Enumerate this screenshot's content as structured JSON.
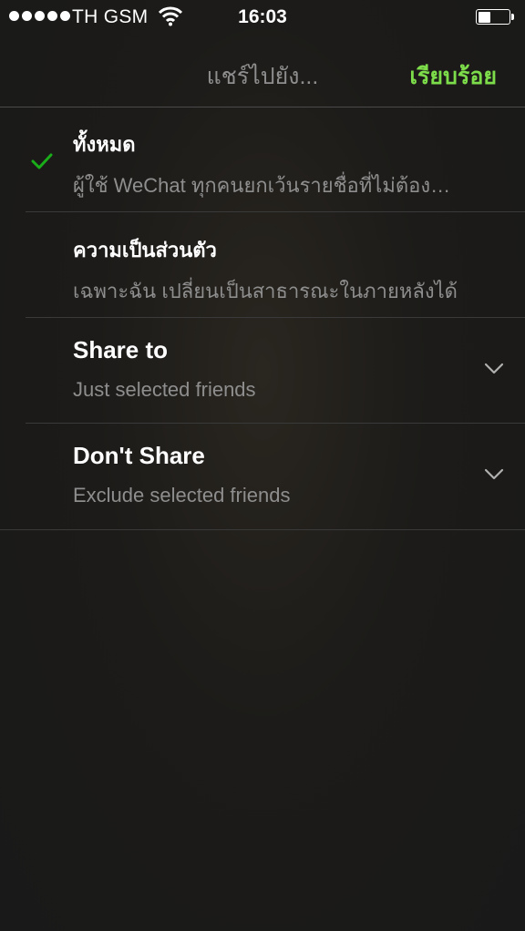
{
  "status_bar": {
    "carrier": "TH GSM",
    "time": "16:03",
    "battery_level": 0.4,
    "signal_dots": 5
  },
  "nav": {
    "title": "แชร์ไปยัง...",
    "done_label": "เรียบร้อย",
    "done_color": "#7ddc4a"
  },
  "options": [
    {
      "title": "ทั้งหมด",
      "subtitle": "ผู้ใช้ WeChat ทุกคนยกเว้นรายชื่อที่ไม่ต้อง…",
      "selected": true
    },
    {
      "title": "ความเป็นส่วนตัว",
      "subtitle": "เฉพาะฉัน เปลี่ยนเป็นสาธารณะในภายหลังได้",
      "selected": false
    },
    {
      "title": "Share to",
      "subtitle": "Just selected friends",
      "selected": false,
      "expandable": true
    },
    {
      "title": "Don't Share",
      "subtitle": "Exclude selected friends",
      "selected": false,
      "expandable": true
    }
  ],
  "icons": {
    "check": "checkmark-icon",
    "chevron": "chevron-down-icon",
    "wifi": "wifi-icon",
    "battery": "battery-icon"
  }
}
